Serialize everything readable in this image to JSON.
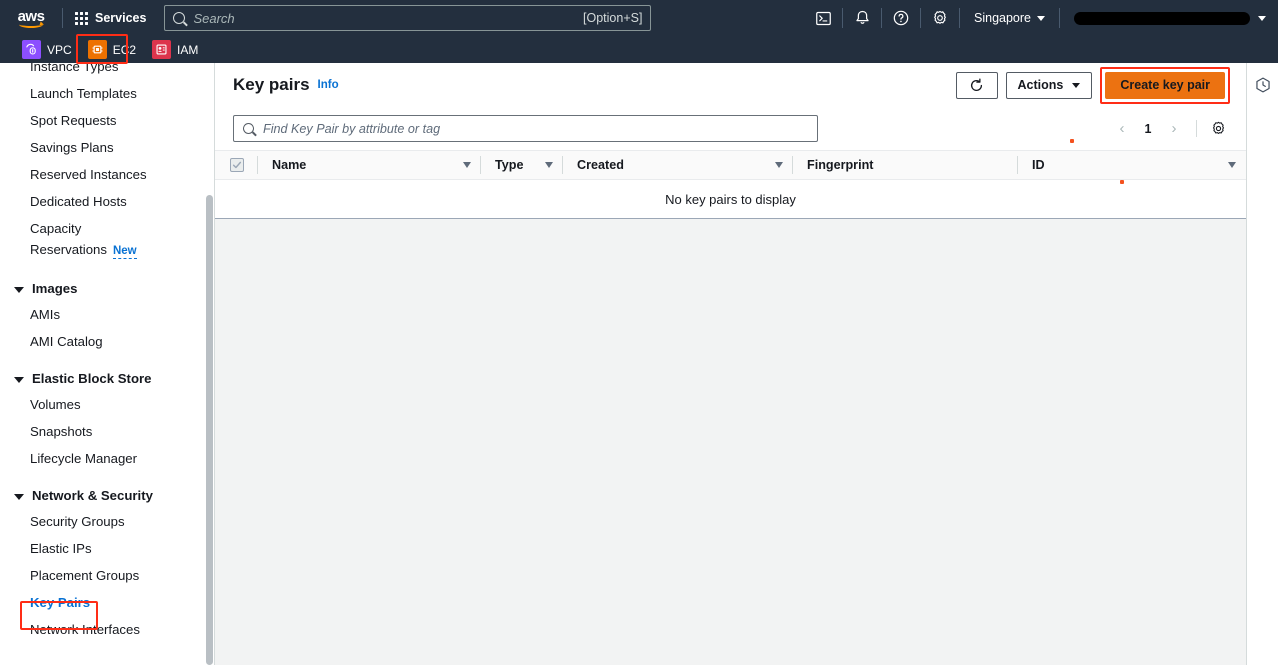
{
  "top_nav": {
    "logo_text": "aws",
    "services_label": "Services",
    "search": {
      "placeholder": "Search",
      "value": "",
      "shortcut_hint": "[Option+S]",
      "icon": "search-icon"
    },
    "icons": [
      {
        "name": "cloudshell-icon",
        "glyph": ">_"
      },
      {
        "name": "notifications-bell-icon",
        "glyph": "bell"
      },
      {
        "name": "help-question-icon",
        "glyph": "?"
      },
      {
        "name": "settings-gear-icon",
        "glyph": "gear"
      }
    ],
    "region_label": "Singapore",
    "account_label": ""
  },
  "shortcut_bar": {
    "items": [
      {
        "label": "VPC",
        "icon": "vpc-service-icon",
        "color": "#8c4fff",
        "highlighted": false
      },
      {
        "label": "EC2",
        "icon": "ec2-service-icon",
        "color": "#ed7100",
        "highlighted": true
      },
      {
        "label": "IAM",
        "icon": "iam-service-icon",
        "color": "#dd344c",
        "highlighted": false
      }
    ]
  },
  "sidebar": {
    "items": [
      {
        "label": "Instance Types",
        "type": "link",
        "active": false
      },
      {
        "label": "Launch Templates",
        "type": "link",
        "active": false
      },
      {
        "label": "Spot Requests",
        "type": "link",
        "active": false
      },
      {
        "label": "Savings Plans",
        "type": "link",
        "active": false
      },
      {
        "label": "Reserved Instances",
        "type": "link",
        "active": false
      },
      {
        "label": "Dedicated Hosts",
        "type": "link",
        "active": false
      },
      {
        "label": "Capacity Reservations",
        "type": "link",
        "active": false,
        "badge": "New"
      },
      {
        "label": "Images",
        "type": "group",
        "expanded": true
      },
      {
        "label": "AMIs",
        "type": "link",
        "active": false
      },
      {
        "label": "AMI Catalog",
        "type": "link",
        "active": false
      },
      {
        "label": "Elastic Block Store",
        "type": "group",
        "expanded": true
      },
      {
        "label": "Volumes",
        "type": "link",
        "active": false
      },
      {
        "label": "Snapshots",
        "type": "link",
        "active": false
      },
      {
        "label": "Lifecycle Manager",
        "type": "link",
        "active": false
      },
      {
        "label": "Network & Security",
        "type": "group",
        "expanded": true
      },
      {
        "label": "Security Groups",
        "type": "link",
        "active": false
      },
      {
        "label": "Elastic IPs",
        "type": "link",
        "active": false
      },
      {
        "label": "Placement Groups",
        "type": "link",
        "active": false
      },
      {
        "label": "Key Pairs",
        "type": "link",
        "active": true
      },
      {
        "label": "Network Interfaces",
        "type": "link",
        "active": false
      }
    ]
  },
  "main": {
    "title": "Key pairs",
    "info_link": "Info",
    "toolbar": {
      "refresh_icon": "refresh-icon",
      "actions_label": "Actions",
      "create_label": "Create key pair"
    },
    "table_search": {
      "placeholder": "Find Key Pair by attribute or tag",
      "value": "",
      "icon": "search-icon"
    },
    "pagination": {
      "prev": "‹",
      "page": "1",
      "next": "›",
      "preferences_icon": "gear-icon"
    },
    "table": {
      "columns": [
        "Name",
        "Type",
        "Created",
        "Fingerprint",
        "ID"
      ],
      "rows": [],
      "empty_message": "No key pairs to display"
    }
  },
  "right_rail": {
    "icon": "history-clock-icon"
  },
  "annotations": {
    "color": "#ff2d16",
    "boxes": [
      "ec2-shortcut",
      "create-key-pair-button",
      "key-pairs-sidebar-item"
    ]
  },
  "colors": {
    "nav_background": "#232f3e",
    "accent_orange": "#ec7211",
    "link_blue": "#0972d3",
    "page_background": "#f2f3f3",
    "annotation_red": "#ff2d16"
  }
}
